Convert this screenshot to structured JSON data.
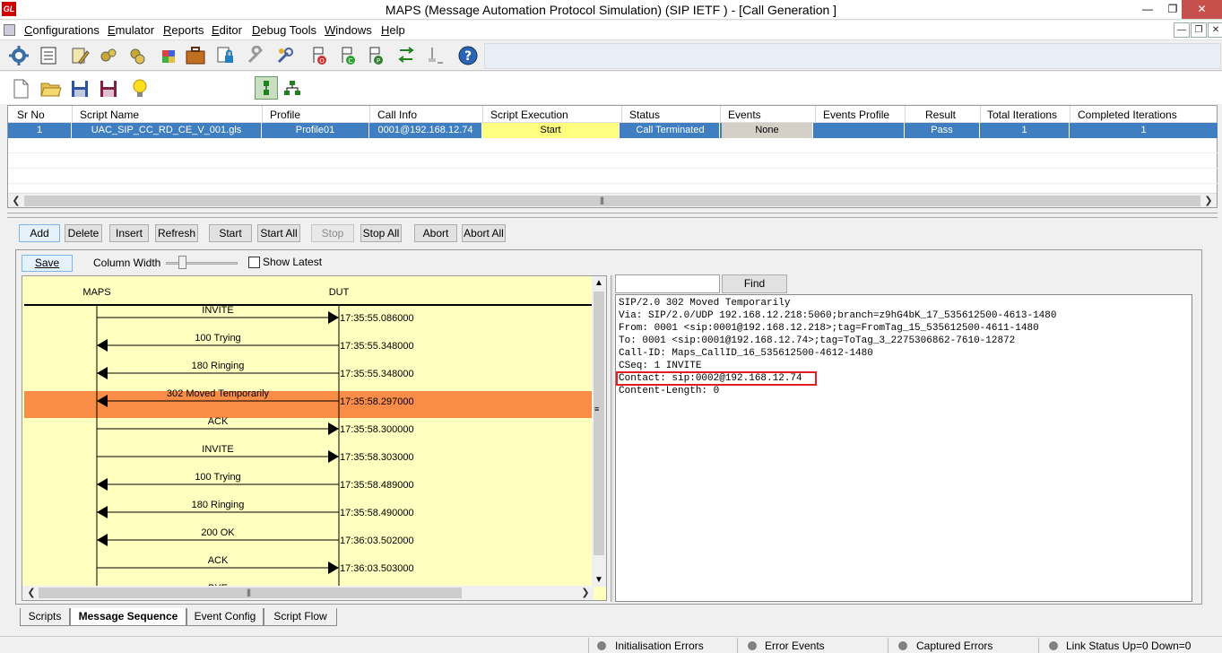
{
  "window": {
    "title": "MAPS (Message Automation Protocol Simulation)  (SIP IETF ) - [Call Generation  ]",
    "logo": "GL",
    "minimize": "—",
    "restore": "❐",
    "close": "✕"
  },
  "menu": {
    "items": [
      {
        "label": "Configurations",
        "u": "C",
        "rest": "onfigurations"
      },
      {
        "label": "Emulator",
        "u": "E",
        "rest": "mulator"
      },
      {
        "label": "Reports",
        "u": "R",
        "rest": "eports"
      },
      {
        "label": "Editor",
        "u": "E",
        "rest": "ditor"
      },
      {
        "label": "Debug Tools",
        "u": "D",
        "rest": "ebug Tools"
      },
      {
        "label": "Windows",
        "u": "W",
        "rest": "indows"
      },
      {
        "label": "Help",
        "u": "H",
        "rest": "elp"
      }
    ],
    "mdi_minimize": "—",
    "mdi_restore": "❐",
    "mdi_close": "✕"
  },
  "grid": {
    "headers": [
      "Sr No",
      "Script Name",
      "Profile",
      "Call Info",
      "Script Execution",
      "Status",
      "Events",
      "Events Profile",
      "Result",
      "Total Iterations",
      "Completed Iterations"
    ],
    "row": {
      "sr_no": "1",
      "script_name": "UAC_SIP_CC_RD_CE_V_001.gls",
      "profile": "Profile01",
      "call_info": "0001@192.168.12.74",
      "script_execution": "Start",
      "status": "Call Terminated",
      "events": "None",
      "events_profile": "",
      "result": "Pass",
      "total_iterations": "1",
      "completed_iterations": "1"
    }
  },
  "buttons": {
    "add": "Add",
    "delete": "Delete",
    "insert": "Insert",
    "refresh": "Refresh",
    "start": "Start",
    "start_all": "Start All",
    "stop": "Stop",
    "stop_all": "Stop All",
    "abort": "Abort",
    "abort_all": "Abort All"
  },
  "seq_panel": {
    "save": "Save",
    "column_width": "Column Width",
    "show_latest": "Show Latest",
    "left_entity": "MAPS",
    "right_entity": "DUT",
    "messages": [
      {
        "label": "INVITE",
        "time": "17:35:55.086000",
        "dir": "right",
        "selected": false
      },
      {
        "label": "100  Trying",
        "time": "17:35:55.348000",
        "dir": "left",
        "selected": false
      },
      {
        "label": "180  Ringing",
        "time": "17:35:55.348000",
        "dir": "left",
        "selected": false
      },
      {
        "label": "302  Moved Temporarily",
        "time": "17:35:58.297000",
        "dir": "left",
        "selected": true
      },
      {
        "label": "ACK",
        "time": "17:35:58.300000",
        "dir": "right",
        "selected": false
      },
      {
        "label": "INVITE",
        "time": "17:35:58.303000",
        "dir": "right",
        "selected": false
      },
      {
        "label": "100  Trying",
        "time": "17:35:58.489000",
        "dir": "left",
        "selected": false
      },
      {
        "label": "180  Ringing",
        "time": "17:35:58.490000",
        "dir": "left",
        "selected": false
      },
      {
        "label": "200  OK",
        "time": "17:36:03.502000",
        "dir": "left",
        "selected": false
      },
      {
        "label": "ACK",
        "time": "17:36:03.503000",
        "dir": "right",
        "selected": false
      },
      {
        "label": "BYE",
        "time": "",
        "dir": "right",
        "selected": false
      }
    ],
    "colors": {
      "background": "#ffffc0",
      "selected": "#f98c46"
    }
  },
  "detail": {
    "find": "Find",
    "find_value": "",
    "lines": [
      "SIP/2.0 302 Moved Temporarily",
      "Via: SIP/2.0/UDP 192.168.12.218:5060;branch=z9hG4bK_17_535612500-4613-1480",
      "From: 0001 <sip:0001@192.168.12.218>;tag=FromTag_15_535612500-4611-1480",
      "To: 0001 <sip:0001@192.168.12.74>;tag=ToTag_3_2275306862-7610-12872",
      "Call-ID: Maps_CallID_16_535612500-4612-1480",
      "CSeq: 1 INVITE",
      "Contact: sip:0002@192.168.12.74",
      "Content-Length: 0"
    ],
    "highlight_color": "#e02020"
  },
  "tabs": [
    "Scripts",
    "Message Sequence",
    "Event Config",
    "Script Flow"
  ],
  "status": {
    "initialization_errors": "Initialisation Errors",
    "error_events": "Error Events",
    "captured_errors": "Captured Errors",
    "link_status": "Link Status Up=0 Down=0"
  }
}
